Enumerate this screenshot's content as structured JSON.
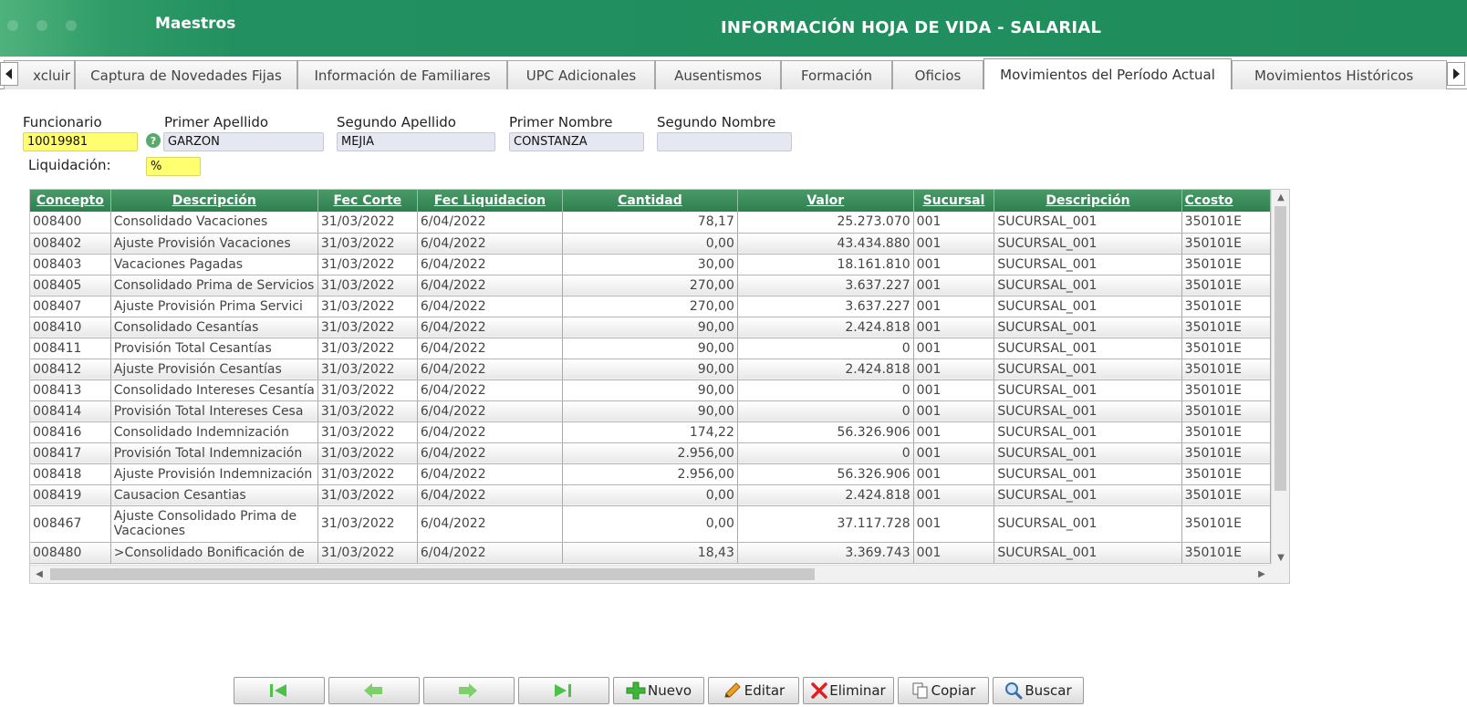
{
  "header": {
    "section": "Maestros",
    "title": "INFORMACIÓN HOJA DE VIDA - SALARIAL"
  },
  "tabs": [
    {
      "label": "xcluir"
    },
    {
      "label": "Captura de Novedades Fijas"
    },
    {
      "label": "Información de Familiares"
    },
    {
      "label": "UPC Adicionales"
    },
    {
      "label": "Ausentismos"
    },
    {
      "label": "Formación"
    },
    {
      "label": "Oficios"
    },
    {
      "label": "Movimientos del Período Actual",
      "active": true
    },
    {
      "label": "Movimientos Históricos"
    }
  ],
  "form": {
    "funcionario": {
      "label": "Funcionario",
      "value": "10019981"
    },
    "primer_apellido": {
      "label": "Primer Apellido",
      "value": "GARZON"
    },
    "segundo_apellido": {
      "label": "Segundo Apellido",
      "value": "MEJIA"
    },
    "primer_nombre": {
      "label": "Primer Nombre",
      "value": "CONSTANZA"
    },
    "segundo_nombre": {
      "label": "Segundo Nombre",
      "value": ""
    },
    "liquidacion": {
      "label": "Liquidación:",
      "value": "%"
    }
  },
  "grid": {
    "columns": [
      "Concepto",
      "Descripción",
      "Fec Corte",
      "Fec Liquidacion",
      "Cantidad",
      "Valor",
      "Sucursal",
      "Descripción",
      "Ccosto"
    ],
    "rows": [
      [
        "008400",
        "Consolidado Vacaciones",
        "31/03/2022",
        "6/04/2022",
        "78,17",
        "25.273.070",
        "001",
        "SUCURSAL_001",
        "350101E"
      ],
      [
        "008402",
        "Ajuste Provisión Vacaciones",
        "31/03/2022",
        "6/04/2022",
        "0,00",
        "43.434.880",
        "001",
        "SUCURSAL_001",
        "350101E"
      ],
      [
        "008403",
        "Vacaciones Pagadas",
        "31/03/2022",
        "6/04/2022",
        "30,00",
        "18.161.810",
        "001",
        "SUCURSAL_001",
        "350101E"
      ],
      [
        "008405",
        "Consolidado Prima de Servicios",
        "31/03/2022",
        "6/04/2022",
        "270,00",
        "3.637.227",
        "001",
        "SUCURSAL_001",
        "350101E"
      ],
      [
        "008407",
        "Ajuste Provisión Prima Servici",
        "31/03/2022",
        "6/04/2022",
        "270,00",
        "3.637.227",
        "001",
        "SUCURSAL_001",
        "350101E"
      ],
      [
        "008410",
        "Consolidado Cesantías",
        "31/03/2022",
        "6/04/2022",
        "90,00",
        "2.424.818",
        "001",
        "SUCURSAL_001",
        "350101E"
      ],
      [
        "008411",
        "Provisión Total Cesantías",
        "31/03/2022",
        "6/04/2022",
        "90,00",
        "0",
        "001",
        "SUCURSAL_001",
        "350101E"
      ],
      [
        "008412",
        "Ajuste Provisión Cesantías",
        "31/03/2022",
        "6/04/2022",
        "90,00",
        "2.424.818",
        "001",
        "SUCURSAL_001",
        "350101E"
      ],
      [
        "008413",
        "Consolidado Intereses Cesantía",
        "31/03/2022",
        "6/04/2022",
        "90,00",
        "0",
        "001",
        "SUCURSAL_001",
        "350101E"
      ],
      [
        "008414",
        "Provisión Total Intereses Cesa",
        "31/03/2022",
        "6/04/2022",
        "90,00",
        "0",
        "001",
        "SUCURSAL_001",
        "350101E"
      ],
      [
        "008416",
        "Consolidado Indemnización",
        "31/03/2022",
        "6/04/2022",
        "174,22",
        "56.326.906",
        "001",
        "SUCURSAL_001",
        "350101E"
      ],
      [
        "008417",
        "Provisión Total Indemnización",
        "31/03/2022",
        "6/04/2022",
        "2.956,00",
        "0",
        "001",
        "SUCURSAL_001",
        "350101E"
      ],
      [
        "008418",
        "Ajuste Provisión Indemnización",
        "31/03/2022",
        "6/04/2022",
        "2.956,00",
        "56.326.906",
        "001",
        "SUCURSAL_001",
        "350101E"
      ],
      [
        "008419",
        "Causacion Cesantias",
        "31/03/2022",
        "6/04/2022",
        "0,00",
        "2.424.818",
        "001",
        "SUCURSAL_001",
        "350101E"
      ],
      [
        "008467",
        "Ajuste Consolidado Prima de Vacaciones",
        "31/03/2022",
        "6/04/2022",
        "0,00",
        "37.117.728",
        "001",
        "SUCURSAL_001",
        "350101E"
      ],
      [
        "008480",
        ">Consolidado Bonificación de",
        "31/03/2022",
        "6/04/2022",
        "18,43",
        "3.369.743",
        "001",
        "SUCURSAL_001",
        "350101E"
      ]
    ]
  },
  "toolbar": {
    "first": "",
    "prev": "",
    "next": "",
    "last": "",
    "nuevo": "Nuevo",
    "editar": "Editar",
    "eliminar": "Eliminar",
    "copiar": "Copiar",
    "buscar": "Buscar"
  },
  "icons": {
    "first": "first-record-icon",
    "prev": "previous-record-icon",
    "next": "next-record-icon",
    "last": "last-record-icon",
    "nuevo": "plus-icon",
    "editar": "pencil-icon",
    "eliminar": "x-icon",
    "copiar": "copy-icon",
    "buscar": "magnifier-icon"
  },
  "colors": {
    "brand": "#229060",
    "header_grid": "#3a8c5a",
    "highlight": "#ffff70"
  }
}
